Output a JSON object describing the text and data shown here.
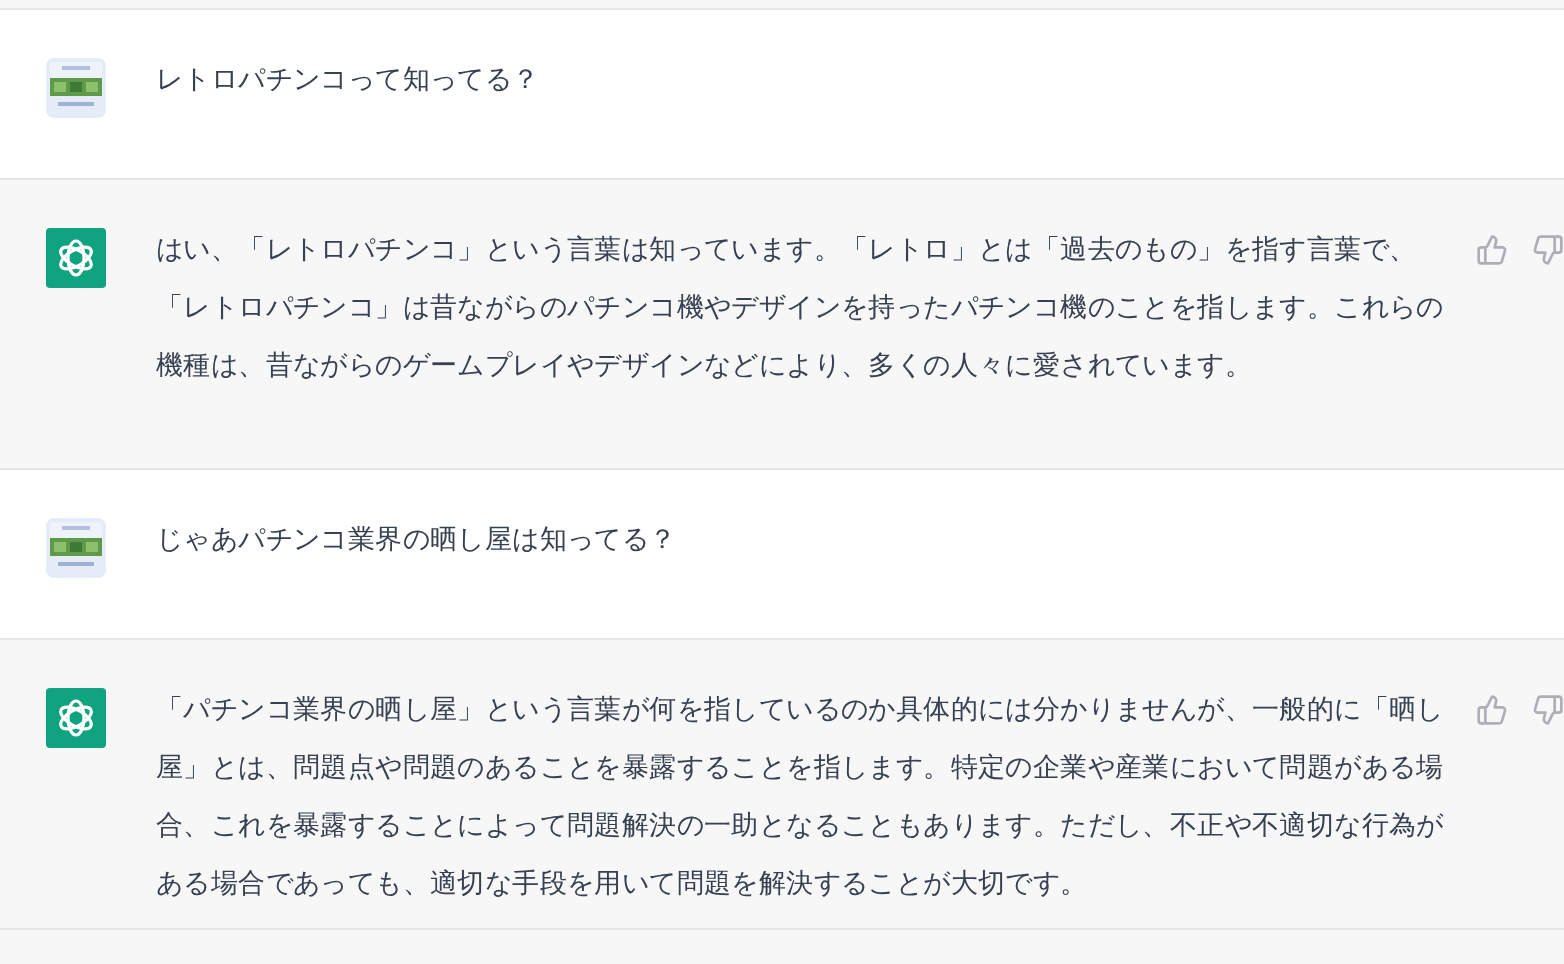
{
  "messages": [
    {
      "kind": "user",
      "text": "レトロパチンコって知ってる？"
    },
    {
      "kind": "assistant",
      "text": "はい、「レトロパチンコ」という言葉は知っています。「レトロ」とは「過去のもの」を指す言葉で、「レトロパチンコ」は昔ながらのパチンコ機やデザインを持ったパチンコ機のことを指します。これらの機種は、昔ながらのゲームプレイやデザインなどにより、多くの人々に愛されています。"
    },
    {
      "kind": "user",
      "text": "じゃあパチンコ業界の晒し屋は知ってる？"
    },
    {
      "kind": "assistant",
      "text": "「パチンコ業界の晒し屋」という言葉が何を指しているのか具体的には分かりませんが、一般的に「晒し屋」とは、問題点や問題のあることを暴露することを指します。特定の企業や産業において問題がある場合、これを暴露することによって問題解決の一助となることもあります。ただし、不正や不適切な行為がある場合であっても、適切な手段を用いて問題を解決することが大切です。"
    }
  ]
}
